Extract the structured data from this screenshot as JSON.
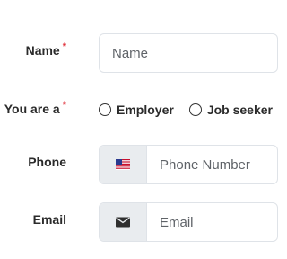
{
  "form": {
    "name": {
      "label": "Name",
      "required_mark": "*",
      "placeholder": "Name",
      "value": ""
    },
    "role": {
      "label": "You are a",
      "required_mark": "*",
      "options": [
        "Employer",
        "Job seeker"
      ],
      "selected": null
    },
    "phone": {
      "label": "Phone",
      "placeholder": "Phone Number",
      "value": "",
      "country_icon": "us-flag-icon"
    },
    "email": {
      "label": "Email",
      "placeholder": "Email",
      "value": "",
      "icon": "envelope-icon"
    }
  },
  "colors": {
    "required": "#e0323c",
    "border": "#dfe3e8",
    "addon_background": "#e9ecef",
    "label_text": "#2b2b2b"
  }
}
